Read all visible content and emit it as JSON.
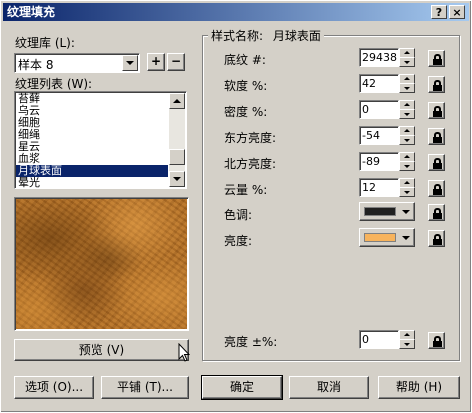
{
  "window": {
    "title": "纹理填充",
    "help_btn": "?",
    "close_btn": "×"
  },
  "left": {
    "library_label": "纹理库 (L):",
    "library_value": "样本 8",
    "add_btn": "+",
    "remove_btn": "−",
    "list_label": "纹理列表 (W):",
    "list_items": [
      "苔藓",
      "乌云",
      "细胞",
      "细绳",
      "星云",
      "血浆",
      "月球表面",
      "晕光"
    ],
    "selected_index": 6,
    "preview_btn": "预览 (V)"
  },
  "group": {
    "title_prefix": "样式名称:",
    "title_value": "月球表面"
  },
  "params": [
    {
      "label": "底纹 #:",
      "value": "29438"
    },
    {
      "label": "软度 %:",
      "value": "42"
    },
    {
      "label": "密度 %:",
      "value": "0"
    },
    {
      "label": "东方亮度:",
      "value": "-54"
    },
    {
      "label": "北方亮度:",
      "value": "-89"
    },
    {
      "label": "云量 %:",
      "value": "12"
    }
  ],
  "color_params": [
    {
      "label": "色调:",
      "color": "#202020"
    },
    {
      "label": "亮度:",
      "color": "#f7b35c"
    }
  ],
  "brightness": {
    "label": "亮度 ±%:",
    "value": "0"
  },
  "bottom_buttons": {
    "options": "选项 (O)...",
    "tile": "平铺 (T)...",
    "ok": "确定",
    "cancel": "取消",
    "help": "帮助 (H)"
  }
}
